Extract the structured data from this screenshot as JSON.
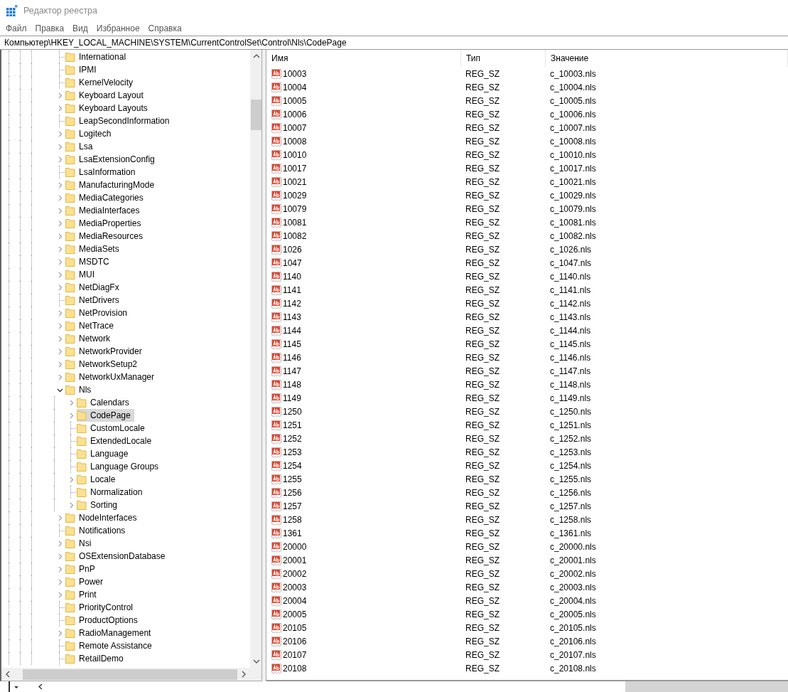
{
  "window": {
    "title": "Редактор реестра"
  },
  "menu": [
    "Файл",
    "Правка",
    "Вид",
    "Избранное",
    "Справка"
  ],
  "address_bar": {
    "value": "Компьютер\\HKEY_LOCAL_MACHINE\\SYSTEM\\CurrentControlSet\\Control\\Nls\\CodePage"
  },
  "tree": {
    "items": [
      {
        "label": "International",
        "expandable": false,
        "expanded": false,
        "selected": false
      },
      {
        "label": "IPMI",
        "expandable": false,
        "expanded": false,
        "selected": false
      },
      {
        "label": "KernelVelocity",
        "expandable": false,
        "expanded": false,
        "selected": false
      },
      {
        "label": "Keyboard Layout",
        "expandable": true,
        "expanded": false,
        "selected": false
      },
      {
        "label": "Keyboard Layouts",
        "expandable": true,
        "expanded": false,
        "selected": false
      },
      {
        "label": "LeapSecondInformation",
        "expandable": false,
        "expanded": false,
        "selected": false
      },
      {
        "label": "Logitech",
        "expandable": true,
        "expanded": false,
        "selected": false
      },
      {
        "label": "Lsa",
        "expandable": true,
        "expanded": false,
        "selected": false
      },
      {
        "label": "LsaExtensionConfig",
        "expandable": true,
        "expanded": false,
        "selected": false
      },
      {
        "label": "LsaInformation",
        "expandable": false,
        "expanded": false,
        "selected": false
      },
      {
        "label": "ManufacturingMode",
        "expandable": true,
        "expanded": false,
        "selected": false
      },
      {
        "label": "MediaCategories",
        "expandable": true,
        "expanded": false,
        "selected": false
      },
      {
        "label": "MediaInterfaces",
        "expandable": true,
        "expanded": false,
        "selected": false
      },
      {
        "label": "MediaProperties",
        "expandable": true,
        "expanded": false,
        "selected": false
      },
      {
        "label": "MediaResources",
        "expandable": true,
        "expanded": false,
        "selected": false
      },
      {
        "label": "MediaSets",
        "expandable": true,
        "expanded": false,
        "selected": false
      },
      {
        "label": "MSDTC",
        "expandable": true,
        "expanded": false,
        "selected": false
      },
      {
        "label": "MUI",
        "expandable": true,
        "expanded": false,
        "selected": false
      },
      {
        "label": "NetDiagFx",
        "expandable": true,
        "expanded": false,
        "selected": false
      },
      {
        "label": "NetDrivers",
        "expandable": false,
        "expanded": false,
        "selected": false
      },
      {
        "label": "NetProvision",
        "expandable": true,
        "expanded": false,
        "selected": false
      },
      {
        "label": "NetTrace",
        "expandable": true,
        "expanded": false,
        "selected": false
      },
      {
        "label": "Network",
        "expandable": true,
        "expanded": false,
        "selected": false
      },
      {
        "label": "NetworkProvider",
        "expandable": true,
        "expanded": false,
        "selected": false
      },
      {
        "label": "NetworkSetup2",
        "expandable": true,
        "expanded": false,
        "selected": false
      },
      {
        "label": "NetworkUxManager",
        "expandable": true,
        "expanded": false,
        "selected": false
      },
      {
        "label": "Nls",
        "expandable": true,
        "expanded": true,
        "selected": false,
        "children": [
          {
            "label": "Calendars",
            "expandable": true,
            "expanded": false,
            "selected": false
          },
          {
            "label": "CodePage",
            "expandable": true,
            "expanded": false,
            "selected": true
          },
          {
            "label": "CustomLocale",
            "expandable": false,
            "expanded": false,
            "selected": false
          },
          {
            "label": "ExtendedLocale",
            "expandable": false,
            "expanded": false,
            "selected": false
          },
          {
            "label": "Language",
            "expandable": false,
            "expanded": false,
            "selected": false
          },
          {
            "label": "Language Groups",
            "expandable": false,
            "expanded": false,
            "selected": false
          },
          {
            "label": "Locale",
            "expandable": true,
            "expanded": false,
            "selected": false
          },
          {
            "label": "Normalization",
            "expandable": false,
            "expanded": false,
            "selected": false
          },
          {
            "label": "Sorting",
            "expandable": true,
            "expanded": false,
            "selected": false
          }
        ]
      },
      {
        "label": "NodeInterfaces",
        "expandable": true,
        "expanded": false,
        "selected": false
      },
      {
        "label": "Notifications",
        "expandable": false,
        "expanded": false,
        "selected": false
      },
      {
        "label": "Nsi",
        "expandable": true,
        "expanded": false,
        "selected": false
      },
      {
        "label": "OSExtensionDatabase",
        "expandable": true,
        "expanded": false,
        "selected": false
      },
      {
        "label": "PnP",
        "expandable": true,
        "expanded": false,
        "selected": false
      },
      {
        "label": "Power",
        "expandable": true,
        "expanded": false,
        "selected": false
      },
      {
        "label": "Print",
        "expandable": true,
        "expanded": false,
        "selected": false
      },
      {
        "label": "PriorityControl",
        "expandable": false,
        "expanded": false,
        "selected": false
      },
      {
        "label": "ProductOptions",
        "expandable": false,
        "expanded": false,
        "selected": false
      },
      {
        "label": "RadioManagement",
        "expandable": true,
        "expanded": false,
        "selected": false
      },
      {
        "label": "Remote Assistance",
        "expandable": false,
        "expanded": false,
        "selected": false
      },
      {
        "label": "RetailDemo",
        "expandable": false,
        "expanded": false,
        "selected": false
      }
    ]
  },
  "values": {
    "columns": [
      "Имя",
      "Тип",
      "Значение"
    ],
    "rows": [
      {
        "name": "10003",
        "type": "REG_SZ",
        "data": "c_10003.nls",
        "selected": false
      },
      {
        "name": "10004",
        "type": "REG_SZ",
        "data": "c_10004.nls",
        "selected": false
      },
      {
        "name": "10005",
        "type": "REG_SZ",
        "data": "c_10005.nls",
        "selected": false
      },
      {
        "name": "10006",
        "type": "REG_SZ",
        "data": "c_10006.nls",
        "selected": false
      },
      {
        "name": "10007",
        "type": "REG_SZ",
        "data": "c_10007.nls",
        "selected": false
      },
      {
        "name": "10008",
        "type": "REG_SZ",
        "data": "c_10008.nls",
        "selected": false
      },
      {
        "name": "10010",
        "type": "REG_SZ",
        "data": "c_10010.nls",
        "selected": false
      },
      {
        "name": "10017",
        "type": "REG_SZ",
        "data": "c_10017.nls",
        "selected": false
      },
      {
        "name": "10021",
        "type": "REG_SZ",
        "data": "c_10021.nls",
        "selected": false
      },
      {
        "name": "10029",
        "type": "REG_SZ",
        "data": "c_10029.nls",
        "selected": false
      },
      {
        "name": "10079",
        "type": "REG_SZ",
        "data": "c_10079.nls",
        "selected": false
      },
      {
        "name": "10081",
        "type": "REG_SZ",
        "data": "c_10081.nls",
        "selected": false
      },
      {
        "name": "10082",
        "type": "REG_SZ",
        "data": "c_10082.nls",
        "selected": false
      },
      {
        "name": "1026",
        "type": "REG_SZ",
        "data": "c_1026.nls",
        "selected": false
      },
      {
        "name": "1047",
        "type": "REG_SZ",
        "data": "c_1047.nls",
        "selected": false
      },
      {
        "name": "1140",
        "type": "REG_SZ",
        "data": "c_1140.nls",
        "selected": false
      },
      {
        "name": "1141",
        "type": "REG_SZ",
        "data": "c_1141.nls",
        "selected": false
      },
      {
        "name": "1142",
        "type": "REG_SZ",
        "data": "c_1142.nls",
        "selected": false
      },
      {
        "name": "1143",
        "type": "REG_SZ",
        "data": "c_1143.nls",
        "selected": false
      },
      {
        "name": "1144",
        "type": "REG_SZ",
        "data": "c_1144.nls",
        "selected": false
      },
      {
        "name": "1145",
        "type": "REG_SZ",
        "data": "c_1145.nls",
        "selected": false
      },
      {
        "name": "1146",
        "type": "REG_SZ",
        "data": "c_1146.nls",
        "selected": false
      },
      {
        "name": "1147",
        "type": "REG_SZ",
        "data": "c_1147.nls",
        "selected": false
      },
      {
        "name": "1148",
        "type": "REG_SZ",
        "data": "c_1148.nls",
        "selected": false
      },
      {
        "name": "1149",
        "type": "REG_SZ",
        "data": "c_1149.nls",
        "selected": false
      },
      {
        "name": "1250",
        "type": "REG_SZ",
        "data": "c_1250.nls",
        "selected": false
      },
      {
        "name": "1251",
        "type": "REG_SZ",
        "data": "c_1251.nls",
        "selected": false
      },
      {
        "name": "1252",
        "type": "REG_SZ",
        "data": "c_1252.nls",
        "selected": false
      },
      {
        "name": "1253",
        "type": "REG_SZ",
        "data": "c_1253.nls",
        "selected": false
      },
      {
        "name": "1254",
        "type": "REG_SZ",
        "data": "c_1254.nls",
        "selected": false
      },
      {
        "name": "1255",
        "type": "REG_SZ",
        "data": "c_1255.nls",
        "selected": false
      },
      {
        "name": "1256",
        "type": "REG_SZ",
        "data": "c_1256.nls",
        "selected": false
      },
      {
        "name": "1257",
        "type": "REG_SZ",
        "data": "c_1257.nls",
        "selected": false
      },
      {
        "name": "1258",
        "type": "REG_SZ",
        "data": "c_1258.nls",
        "selected": false
      },
      {
        "name": "1361",
        "type": "REG_SZ",
        "data": "c_1361.nls",
        "selected": false
      },
      {
        "name": "20000",
        "type": "REG_SZ",
        "data": "c_20000.nls",
        "selected": false
      },
      {
        "name": "20001",
        "type": "REG_SZ",
        "data": "c_20001.nls",
        "selected": false
      },
      {
        "name": "20002",
        "type": "REG_SZ",
        "data": "c_20002.nls",
        "selected": false
      },
      {
        "name": "20003",
        "type": "REG_SZ",
        "data": "c_20003.nls",
        "selected": false
      },
      {
        "name": "20004",
        "type": "REG_SZ",
        "data": "c_20004.nls",
        "selected": false
      },
      {
        "name": "20005",
        "type": "REG_SZ",
        "data": "c_20005.nls",
        "selected": false
      },
      {
        "name": "20105",
        "type": "REG_SZ",
        "data": "c_20105.nls",
        "selected": false
      },
      {
        "name": "20106",
        "type": "REG_SZ",
        "data": "c_20106.nls",
        "selected": false
      },
      {
        "name": "20107",
        "type": "REG_SZ",
        "data": "c_20107.nls",
        "selected": false
      },
      {
        "name": "20108",
        "type": "REG_SZ",
        "data": "c_20108.nls",
        "selected": false
      }
    ]
  }
}
